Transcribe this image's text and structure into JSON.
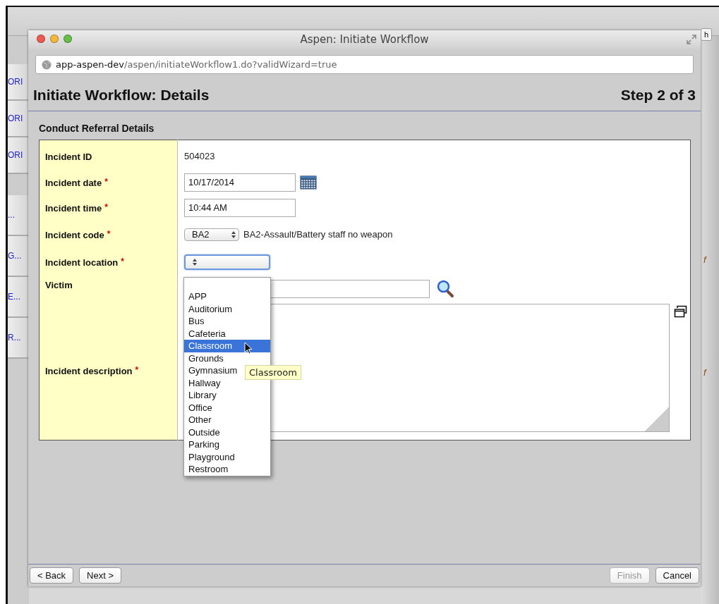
{
  "background_page": {
    "sidebar_links": [
      "ORI",
      "ORI",
      "ORI",
      "...",
      "G...",
      "E...",
      "R..."
    ],
    "search_button": "h",
    "side_marks": [
      "f",
      "f"
    ]
  },
  "window": {
    "title": "Aspen: Initiate Workflow"
  },
  "address_bar": {
    "host": "app-aspen-dev",
    "path": "/aspen/initiateWorkflow1.do?validWizard=true"
  },
  "page": {
    "title": "Initiate Workflow: Details",
    "step": "Step 2 of 3"
  },
  "section": {
    "title": "Conduct Referral Details",
    "fields": [
      {
        "kind": "text",
        "label": "Incident ID",
        "value": "504023"
      },
      {
        "kind": "date",
        "label": "Incident date",
        "required_mark": "*",
        "value": "10/17/2014"
      },
      {
        "kind": "input",
        "label": "Incident time",
        "required_mark": "*",
        "value": "10:44 AM"
      },
      {
        "kind": "code",
        "label": "Incident code",
        "required_mark": "*",
        "value": "BA2",
        "description": "BA2-Assault/Battery staff no weapon"
      },
      {
        "kind": "select",
        "label": "Incident location",
        "required_mark": "*",
        "focused": true
      },
      {
        "kind": "lookup",
        "label": "Victim"
      },
      {
        "kind": "textarea",
        "label": "Incident description",
        "required_mark": "*"
      }
    ]
  },
  "location_dropdown": {
    "options": [
      {
        "label": "APP",
        "selected": false
      },
      {
        "label": "Auditorium",
        "selected": false
      },
      {
        "label": "Bus",
        "selected": false
      },
      {
        "label": "Cafeteria",
        "selected": false
      },
      {
        "label": "Classroom",
        "selected": true
      },
      {
        "label": "Grounds",
        "selected": false
      },
      {
        "label": "Gymnasium",
        "selected": false
      },
      {
        "label": "Hallway",
        "selected": false
      },
      {
        "label": "Library",
        "selected": false
      },
      {
        "label": "Office",
        "selected": false
      },
      {
        "label": "Other",
        "selected": false
      },
      {
        "label": "Outside",
        "selected": false
      },
      {
        "label": "Parking",
        "selected": false
      },
      {
        "label": "Playground",
        "selected": false
      },
      {
        "label": "Restroom",
        "selected": false
      }
    ],
    "tooltip": "Classroom"
  },
  "footer": {
    "left_buttons": [
      {
        "label": "< Back",
        "disabled": false
      },
      {
        "label": "Next >",
        "disabled": false
      }
    ],
    "right_buttons": [
      {
        "label": "Finish",
        "disabled": true
      },
      {
        "label": "Cancel",
        "disabled": false
      }
    ]
  }
}
